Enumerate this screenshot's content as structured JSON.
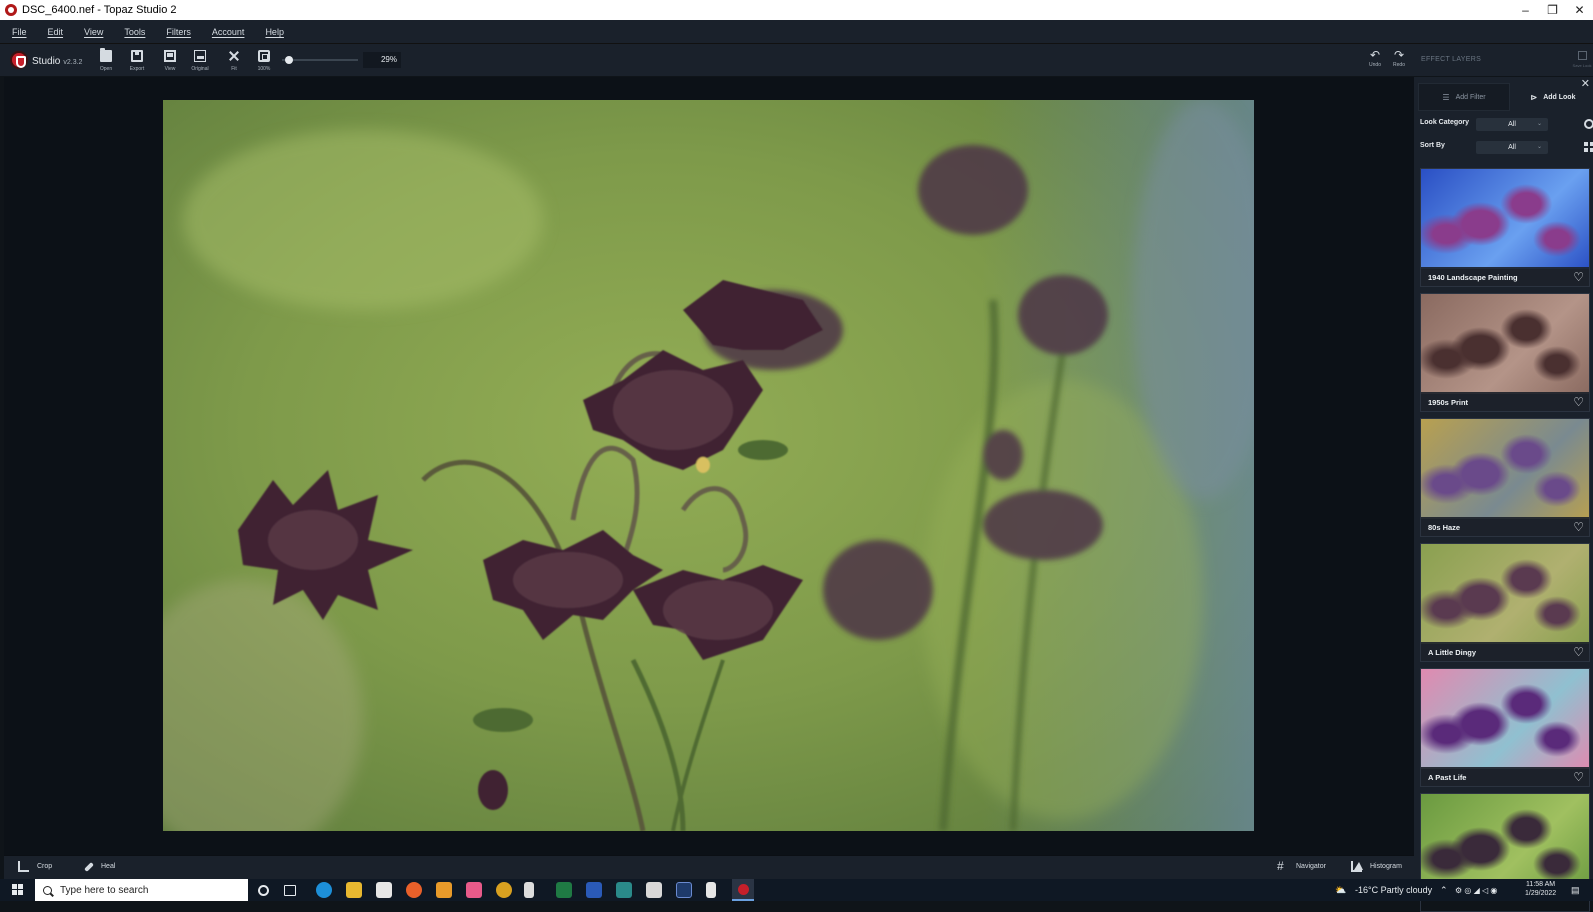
{
  "window": {
    "title": "DSC_6400.nef - Topaz Studio 2",
    "minimize": "–",
    "restore": "❐",
    "close": "✕"
  },
  "menu": [
    "File",
    "Edit",
    "View",
    "Tools",
    "Filters",
    "Account",
    "Help"
  ],
  "toolbar": {
    "app_name": "Studio",
    "version": "v2.3.2",
    "buttons": {
      "open": "Open",
      "export": "Export",
      "view": "View",
      "original": "Original",
      "fit": "Fit",
      "zoom100": "100%"
    },
    "zoom_value": "29%",
    "zoom_slider_fraction": 0.05,
    "undo": "Undo",
    "redo": "Redo",
    "effect_layers": "EFFECT LAYERS",
    "save_look": "Save Look"
  },
  "bottom_bar": {
    "crop": "Crop",
    "heal": "Heal",
    "navigator": "Navigator",
    "histogram": "Histogram"
  },
  "panel": {
    "close": "✕",
    "tab_add_filter": "Add Filter",
    "tab_add_look": "Add Look",
    "look_category_label": "Look Category",
    "look_category_value": "All",
    "sort_by_label": "Sort By",
    "sort_by_value": "All",
    "looks": [
      {
        "name": "1940 Landscape Painting",
        "colors": [
          "#2a4fc4",
          "#6aa0f0",
          "#8a3c8c"
        ]
      },
      {
        "name": "1950s Print",
        "colors": [
          "#8a6a60",
          "#b49488",
          "#4a3030"
        ]
      },
      {
        "name": "80s Haze",
        "colors": [
          "#b8a050",
          "#7a8a90",
          "#6a4a8a"
        ]
      },
      {
        "name": "A Little Dingy",
        "colors": [
          "#8aa050",
          "#b0b070",
          "#5a3a50"
        ]
      },
      {
        "name": "A Past Life",
        "colors": [
          "#e08ab0",
          "#90c0d0",
          "#5a2a7a"
        ]
      },
      {
        "name": "",
        "colors": [
          "#6a9a40",
          "#a0c060",
          "#3a2a3a"
        ]
      }
    ]
  },
  "taskbar": {
    "search_placeholder": "Type here to search",
    "weather": "-16°C  Partly cloudy",
    "time": "11:58 AM",
    "date": "1/29/2022"
  }
}
